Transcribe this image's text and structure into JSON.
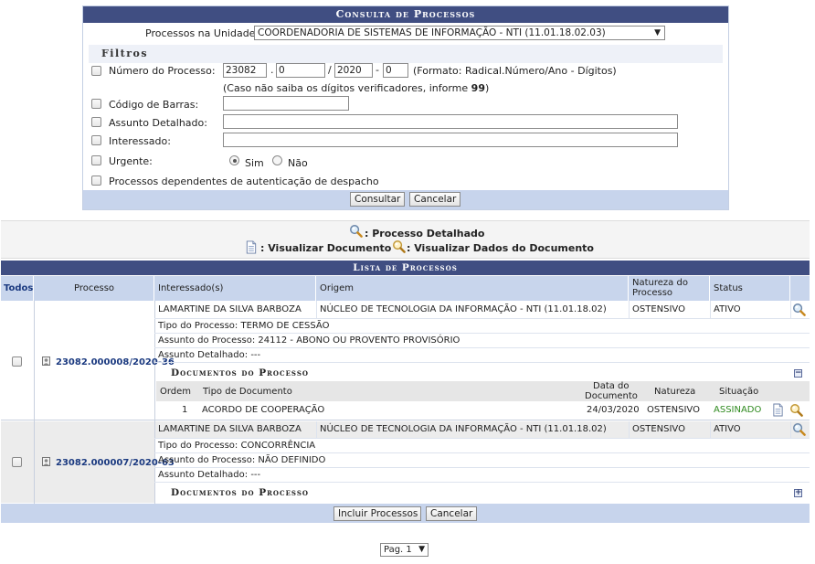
{
  "filter_panel": {
    "title": "Consulta de Processos",
    "unit_label": "Processos na Unidade:",
    "unit_value": "COORDENADORIA DE SISTEMAS DE INFORMAÇÃO - NTI (11.01.18.02.03)",
    "filters_title": "Filtros",
    "numero_label": "Número do Processo:",
    "numero_radical": "23082",
    "numero_numero": "0",
    "numero_ano": "2020",
    "numero_digitos": "0",
    "sep_dot": ".",
    "sep_slash": "/",
    "sep_dash": "-",
    "numero_format": "(Formato: Radical.Número/Ano - Dígitos)",
    "numero_hint_pre": "(Caso não saiba os dígitos verificadores, informe ",
    "numero_hint_bold": "99",
    "numero_hint_post": ")",
    "codigo_label": "Código de Barras:",
    "assunto_label": "Assunto Detalhado:",
    "interessado_label": "Interessado:",
    "urgente_label": "Urgente:",
    "urgente_sim": "Sim",
    "urgente_nao": "Não",
    "dependentes_label": "Processos dependentes de autenticação de despacho",
    "consultar_button": "Consultar",
    "cancelar_button": "Cancelar"
  },
  "legend": {
    "detalhado": ": Processo Detalhado",
    "visualizar_documento": ": Visualizar Documento",
    "visualizar_dados": ": Visualizar Dados do Documento"
  },
  "list": {
    "title": "Lista de Processos",
    "headers": {
      "todos": "Todos",
      "processo": "Processo",
      "interessados": "Interessado(s)",
      "origem": "Origem",
      "natureza_1": "Natureza do",
      "natureza_2": "Processo",
      "status": "Status"
    },
    "labels": {
      "tipo": "Tipo do Processo:",
      "assunto": "Assunto do Processo:",
      "assunto_detalhado": "Assunto Detalhado:",
      "documentos": "Documentos do Processo"
    },
    "doc_headers": {
      "ordem": "Ordem",
      "tipo": "Tipo de Documento",
      "data_1": "Data do",
      "data_2": "Documento",
      "natureza": "Natureza",
      "situacao": "Situação"
    },
    "processes": [
      {
        "numero": "23082.000008/2020-36",
        "interessado": "LAMARTINE DA SILVA BARBOZA",
        "origem": "NÚCLEO DE TECNOLOGIA DA INFORMAÇÃO - NTI (11.01.18.02)",
        "natureza": "OSTENSIVO",
        "status": "ATIVO",
        "tipo": "TERMO DE CESSÃO",
        "assunto": "24112 - ABONO OU PROVENTO PROVISÓRIO",
        "assunto_detalhado": "---",
        "documents": [
          {
            "ordem": "1",
            "tipo": "ACORDO DE COOPERAÇÃO",
            "data": "24/03/2020",
            "natureza": "OSTENSIVO",
            "situacao": "ASSINADO"
          }
        ]
      },
      {
        "numero": "23082.000007/2020-63",
        "interessado": "LAMARTINE DA SILVA BARBOZA",
        "origem": "NÚCLEO DE TECNOLOGIA DA INFORMAÇÃO - NTI (11.01.18.02)",
        "natureza": "OSTENSIVO",
        "status": "ATIVO",
        "tipo": "CONCORRÊNCIA",
        "assunto": "NÃO DEFINIDO",
        "assunto_detalhado": "---",
        "documents": []
      }
    ],
    "incluir_button": "Incluir Processos",
    "cancelar_button": "Cancelar"
  },
  "pagination": {
    "label": "Pag. 1"
  },
  "icons": {
    "search": "magnifier-icon",
    "document": "document-icon",
    "document_data": "document-data-icon",
    "process": "process-icon",
    "collapse": "minus-box-icon",
    "expand": "plus-box-icon"
  },
  "colors": {
    "header_bar": "#404e82",
    "column_header": "#c8d5ec",
    "button_bar": "#c7d4ec",
    "link": "#1b3a80",
    "signed": "#2f8a1f"
  }
}
